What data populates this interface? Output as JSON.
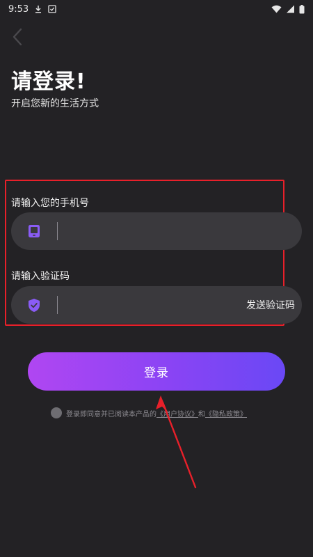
{
  "status_bar": {
    "time": "9:53",
    "icons": [
      "download-icon",
      "notification-icon",
      "wifi-icon",
      "signal-icon",
      "battery-icon"
    ]
  },
  "header": {
    "back_icon": "chevron-left-icon",
    "title": "请登录!",
    "subtitle": "开启您新的生活方式"
  },
  "form": {
    "phone": {
      "label": "请输入您的手机号",
      "icon": "phone-icon",
      "value": "",
      "placeholder": ""
    },
    "code": {
      "label": "请输入验证码",
      "icon": "shield-check-icon",
      "value": "",
      "placeholder": "",
      "send_label": "发送验证码"
    }
  },
  "login_button": {
    "label": "登录"
  },
  "agreement": {
    "text_prefix": "登录即同意并已阅读本产品的",
    "user_agreement": "《用户协议》",
    "conjunction": "和",
    "privacy_policy": "《隐私政策》"
  },
  "colors": {
    "background": "#232225",
    "input_background": "#3a393d",
    "accent_start": "#b046f2",
    "accent_end": "#6a48f5",
    "icon_purple": "#8a5cf6",
    "highlight_red": "#e8202a"
  }
}
